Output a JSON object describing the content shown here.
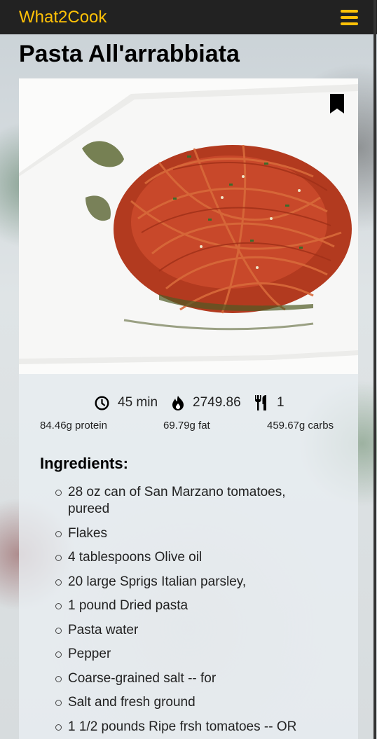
{
  "navbar": {
    "brand": "What2Cook",
    "menu_icon": "hamburger-menu-icon",
    "accent_color": "#ffc107"
  },
  "recipe": {
    "title": "Pasta All'arrabbiata",
    "bookmark_icon": "bookmark-icon",
    "stats": {
      "time": "45 min",
      "calories": "2749.86",
      "servings": "1"
    },
    "macros": {
      "protein": "84.46g protein",
      "fat": "69.79g fat",
      "carbs": "459.67g carbs"
    },
    "ingredients_heading": "Ingredients:",
    "ingredients": [
      "28 oz can of San Marzano tomatoes, pureed",
      "Flakes",
      "4 tablespoons Olive oil",
      "20 large Sprigs Italian parsley,",
      "1 pound Dried pasta",
      "Pasta water",
      "Pepper",
      "Coarse-grained salt -- for",
      "Salt and fresh ground",
      "1 1/2 pounds Ripe frsh tomatoes -- OR"
    ]
  }
}
